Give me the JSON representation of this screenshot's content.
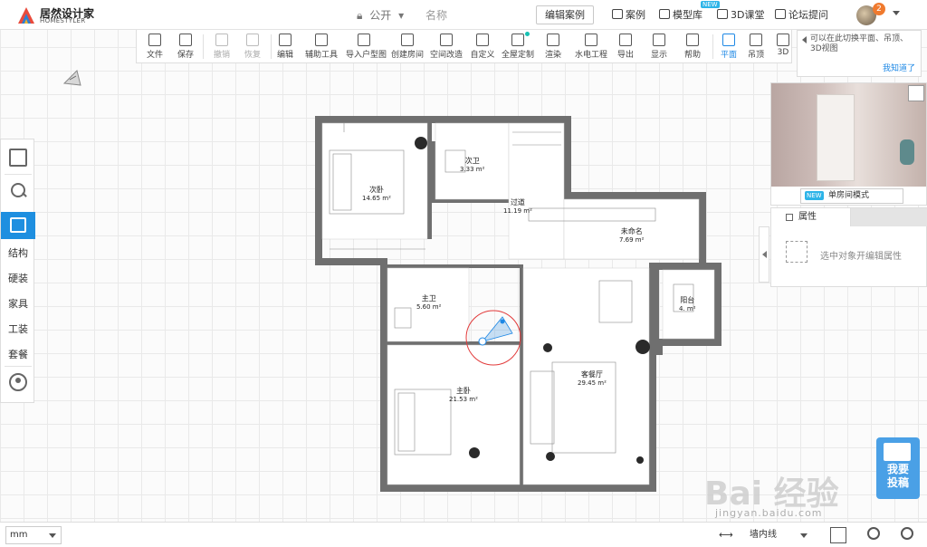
{
  "app": {
    "logo_name": "居然设计家",
    "logo_sub": "HOMESTYLER"
  },
  "topbar": {
    "visibility": "公开",
    "doc_name": "名称",
    "edit_case": "编辑案例",
    "links": [
      {
        "label": "案例",
        "icon": "case-icon"
      },
      {
        "label": "模型库",
        "icon": "model-library-icon",
        "badge": "NEW"
      },
      {
        "label": "3D课堂",
        "icon": "3d-class-icon"
      },
      {
        "label": "论坛提问",
        "icon": "forum-icon"
      }
    ],
    "notification_count": "2"
  },
  "toolbar": {
    "items": [
      {
        "label": "文件",
        "icon": "file-icon"
      },
      {
        "label": "保存",
        "icon": "save-icon"
      },
      {
        "label": "撤销",
        "icon": "undo-icon",
        "disabled": true
      },
      {
        "label": "恢复",
        "icon": "redo-icon",
        "disabled": true
      },
      {
        "label": "编辑",
        "icon": "edit-icon"
      },
      {
        "label": "辅助工具",
        "icon": "ruler-icon"
      },
      {
        "label": "导入户型图",
        "icon": "import-floorplan-icon"
      },
      {
        "label": "创建房间",
        "icon": "create-room-icon"
      },
      {
        "label": "空间改造",
        "icon": "space-remodel-icon"
      },
      {
        "label": "自定义",
        "icon": "custom-icon"
      },
      {
        "label": "全屋定制",
        "icon": "whole-house-icon"
      },
      {
        "label": "渲染",
        "icon": "render-teapot-icon"
      },
      {
        "label": "水电工程",
        "icon": "plumbing-electric-icon"
      },
      {
        "label": "导出",
        "icon": "export-icon"
      },
      {
        "label": "显示",
        "icon": "eye-icon"
      },
      {
        "label": "帮助",
        "icon": "help-icon"
      },
      {
        "label": "平面",
        "icon": "plan-view-icon",
        "active": true
      },
      {
        "label": "吊顶",
        "icon": "ceiling-icon"
      },
      {
        "label": "3D",
        "icon": "3d-cube-icon"
      }
    ]
  },
  "tip": {
    "text": "可以在此切换平面、吊顶、3D视图",
    "ok": "我知道了"
  },
  "sidebar": {
    "items": [
      {
        "label": "结构"
      },
      {
        "label": "硬装"
      },
      {
        "label": "家具"
      },
      {
        "label": "工装"
      },
      {
        "label": "套餐"
      }
    ]
  },
  "preview": {
    "mode_badge": "NEW",
    "mode_label": "单房间模式"
  },
  "properties": {
    "tab": "属性",
    "hint": "选中对象开编辑属性"
  },
  "bottombar": {
    "unit": "mm",
    "wall_mode": "墙内线"
  },
  "watermark": {
    "big": "Bai 经验",
    "small": "jingyan.baidu.com"
  },
  "submit_badge": {
    "line1": "我要",
    "line2": "投稿"
  },
  "rooms": [
    {
      "name": "次卧",
      "area": "14.65 m²"
    },
    {
      "name": "次卫",
      "area": "3.33 m²"
    },
    {
      "name": "过道",
      "area": "11.19 m²"
    },
    {
      "name": "未命名",
      "area": "7.69 m²"
    },
    {
      "name": "主卫",
      "area": "5.60 m²"
    },
    {
      "name": "阳台",
      "area": "4. m²"
    },
    {
      "name": "主卧",
      "area": "21.53 m²"
    },
    {
      "name": "客餐厅",
      "area": "29.45 m²"
    }
  ]
}
